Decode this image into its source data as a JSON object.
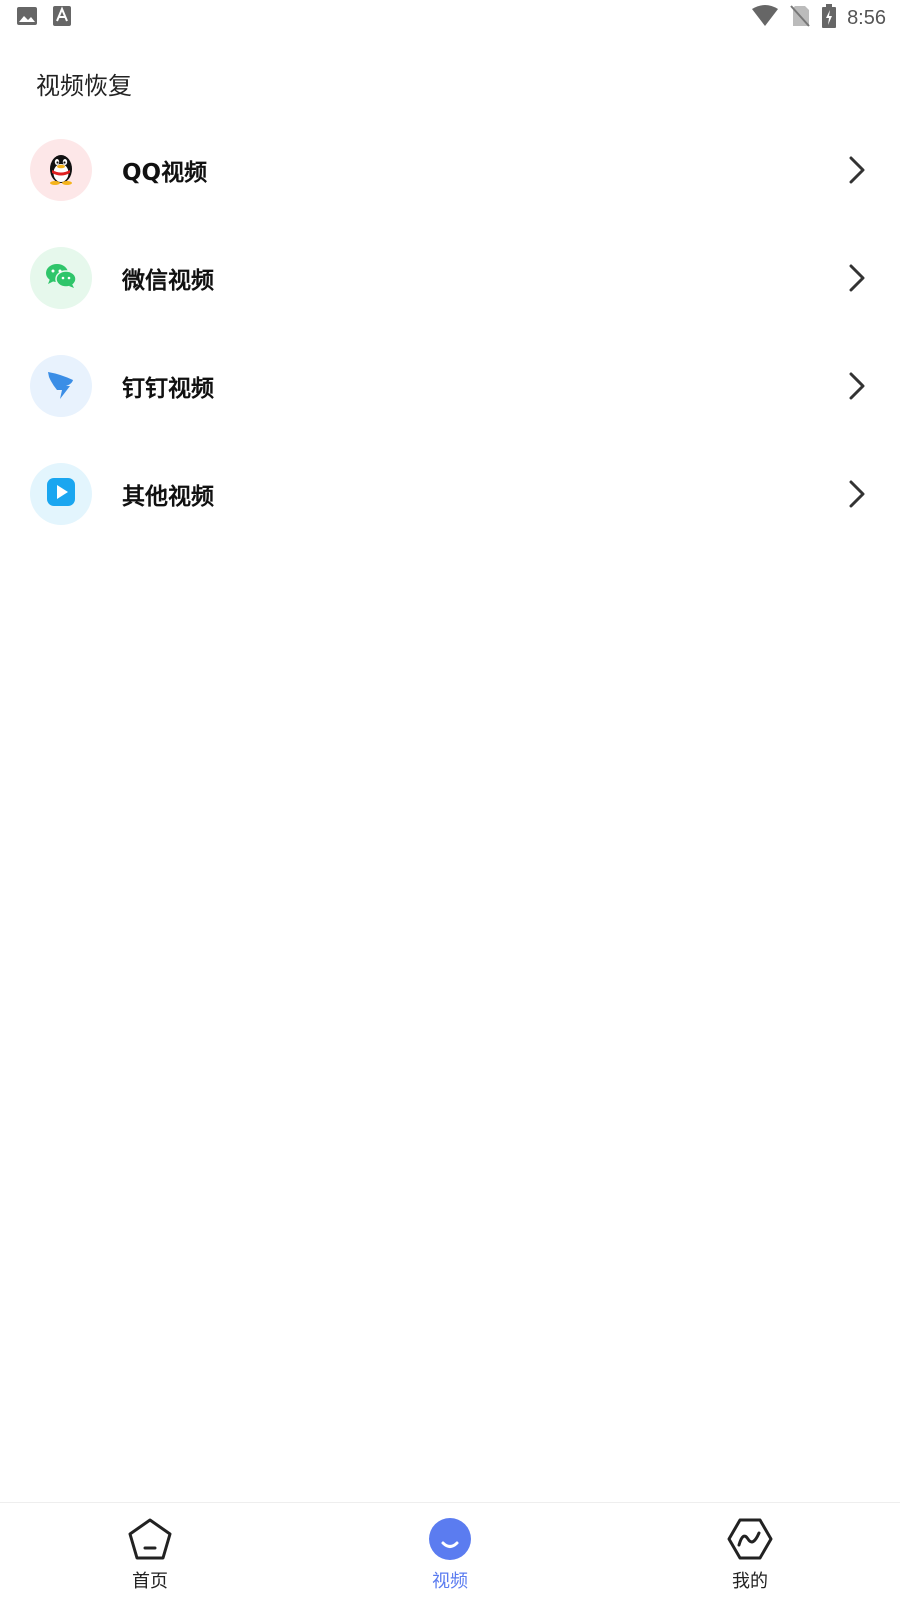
{
  "status_bar": {
    "time": "8:56",
    "left_icons": [
      "image-icon",
      "font-a-icon"
    ],
    "right_icons": [
      "wifi-icon",
      "no-sim-icon",
      "battery-charging-icon"
    ]
  },
  "page": {
    "title": "视频恢复"
  },
  "list": [
    {
      "label": "QQ视频",
      "icon": "qq-penguin-icon",
      "icon_bg": "#fde7e8"
    },
    {
      "label": "微信视频",
      "icon": "wechat-icon",
      "icon_bg": "#e6f8ec"
    },
    {
      "label": "钉钉视频",
      "icon": "dingtalk-icon",
      "icon_bg": "#e8f2fd"
    },
    {
      "label": "其他视频",
      "icon": "play-icon",
      "icon_bg": "#e3f5fd"
    }
  ],
  "tabbar": {
    "tabs": [
      {
        "label": "首页",
        "icon": "home-pentagon-icon",
        "active": false
      },
      {
        "label": "视频",
        "icon": "video-face-icon",
        "active": true
      },
      {
        "label": "我的",
        "icon": "profile-hexagon-icon",
        "active": false
      }
    ],
    "active_color": "#5b7cf0"
  }
}
